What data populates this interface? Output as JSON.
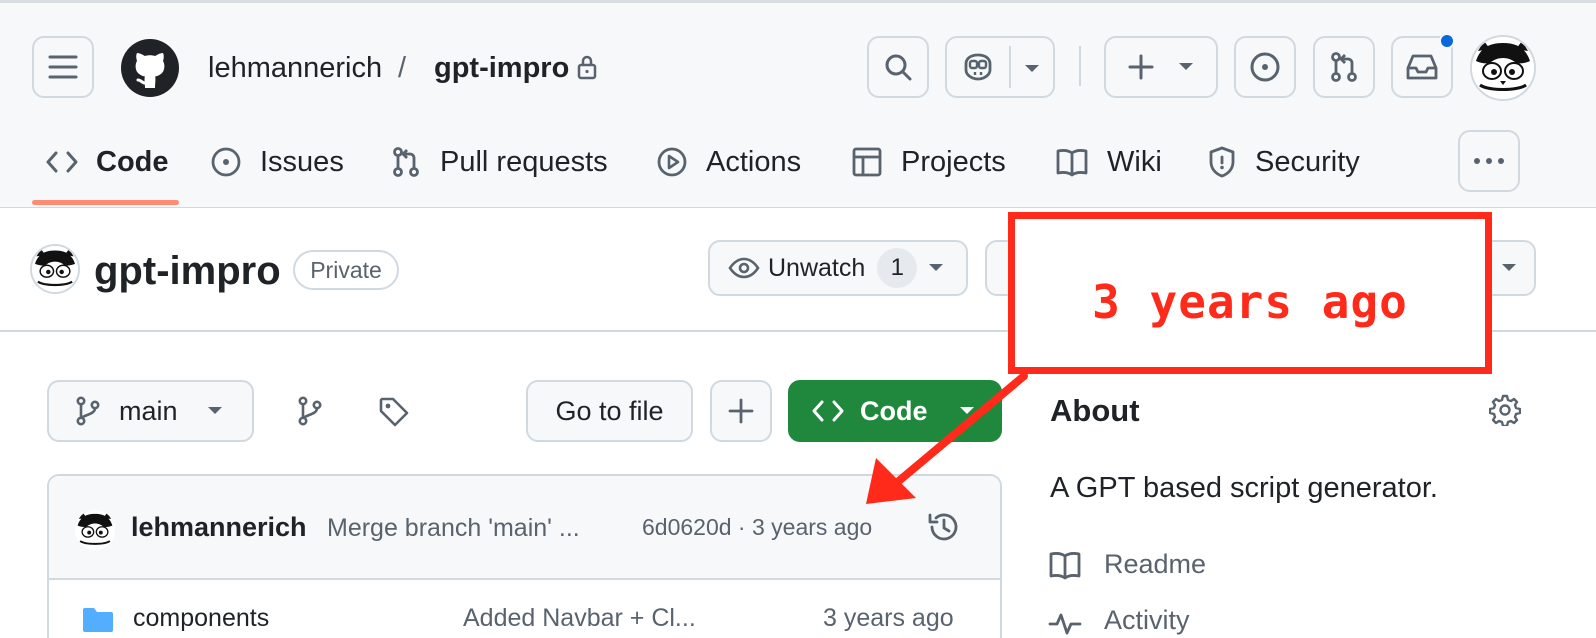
{
  "header": {
    "owner": "lehmannerich",
    "separator": "/",
    "repo": "gpt-impro",
    "notification_dot_color": "#0969da"
  },
  "tabs": [
    {
      "label": "Code",
      "icon": "code-icon",
      "selected": true
    },
    {
      "label": "Issues",
      "icon": "issue-icon"
    },
    {
      "label": "Pull requests",
      "icon": "pull-request-icon"
    },
    {
      "label": "Actions",
      "icon": "play-icon"
    },
    {
      "label": "Projects",
      "icon": "table-icon"
    },
    {
      "label": "Wiki",
      "icon": "book-icon"
    },
    {
      "label": "Security",
      "icon": "shield-icon"
    }
  ],
  "repo_header": {
    "title": "gpt-impro",
    "visibility": "Private",
    "unwatch_label": "Unwatch",
    "watch_count": "1"
  },
  "toolbar": {
    "branch": "main",
    "go_to_file": "Go to file",
    "code_label": "Code",
    "code_button_color": "#1f883d"
  },
  "latest_commit": {
    "author": "lehmannerich",
    "message": "Merge branch 'main' ...",
    "meta": "6d0620d · 3 years ago"
  },
  "files": [
    {
      "name": "components",
      "message": "Added Navbar + Cl...",
      "time": "3 years ago"
    }
  ],
  "about": {
    "heading": "About",
    "description": "A GPT based script generator.",
    "links": [
      "Readme",
      "Activity"
    ]
  },
  "annotation": {
    "text": "3 years ago",
    "color": "#ff2a1a"
  }
}
